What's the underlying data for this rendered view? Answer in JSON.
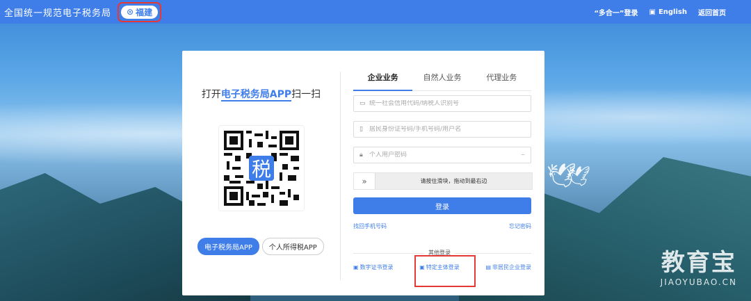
{
  "header": {
    "brand": "全国统一规范电子税务局",
    "region": "福建",
    "multi_login": "“多合一”登录",
    "english": "English",
    "home": "返回首页"
  },
  "left_panel": {
    "scan_prefix": "打开",
    "scan_app": "电子税务局APP",
    "scan_suffix": "扫一扫",
    "app_buttons": [
      "电子税务局APP",
      "个人所得税APP"
    ]
  },
  "tabs": [
    "企业业务",
    "自然人业务",
    "代理业务"
  ],
  "form": {
    "credit_code_placeholder": "统一社会信用代码/纳税人识别号",
    "id_placeholder": "居民身份证号码/手机号码/用户名",
    "password_placeholder": "个人用户密码",
    "slider_text": "请按住滑块，拖动到最右边",
    "login": "登录",
    "recover_phone": "找回手机号码",
    "forgot_password": "忘记密码"
  },
  "other_login": {
    "label": "其他登录",
    "items": [
      "数字证书登录",
      "特定主体登录",
      "非居民企业登录"
    ]
  },
  "watermark": {
    "cn": "教育宝",
    "en": "JIAOYUBAO.CN"
  },
  "colors": {
    "accent": "#3f7ee8",
    "highlight_box": "#e53935"
  }
}
